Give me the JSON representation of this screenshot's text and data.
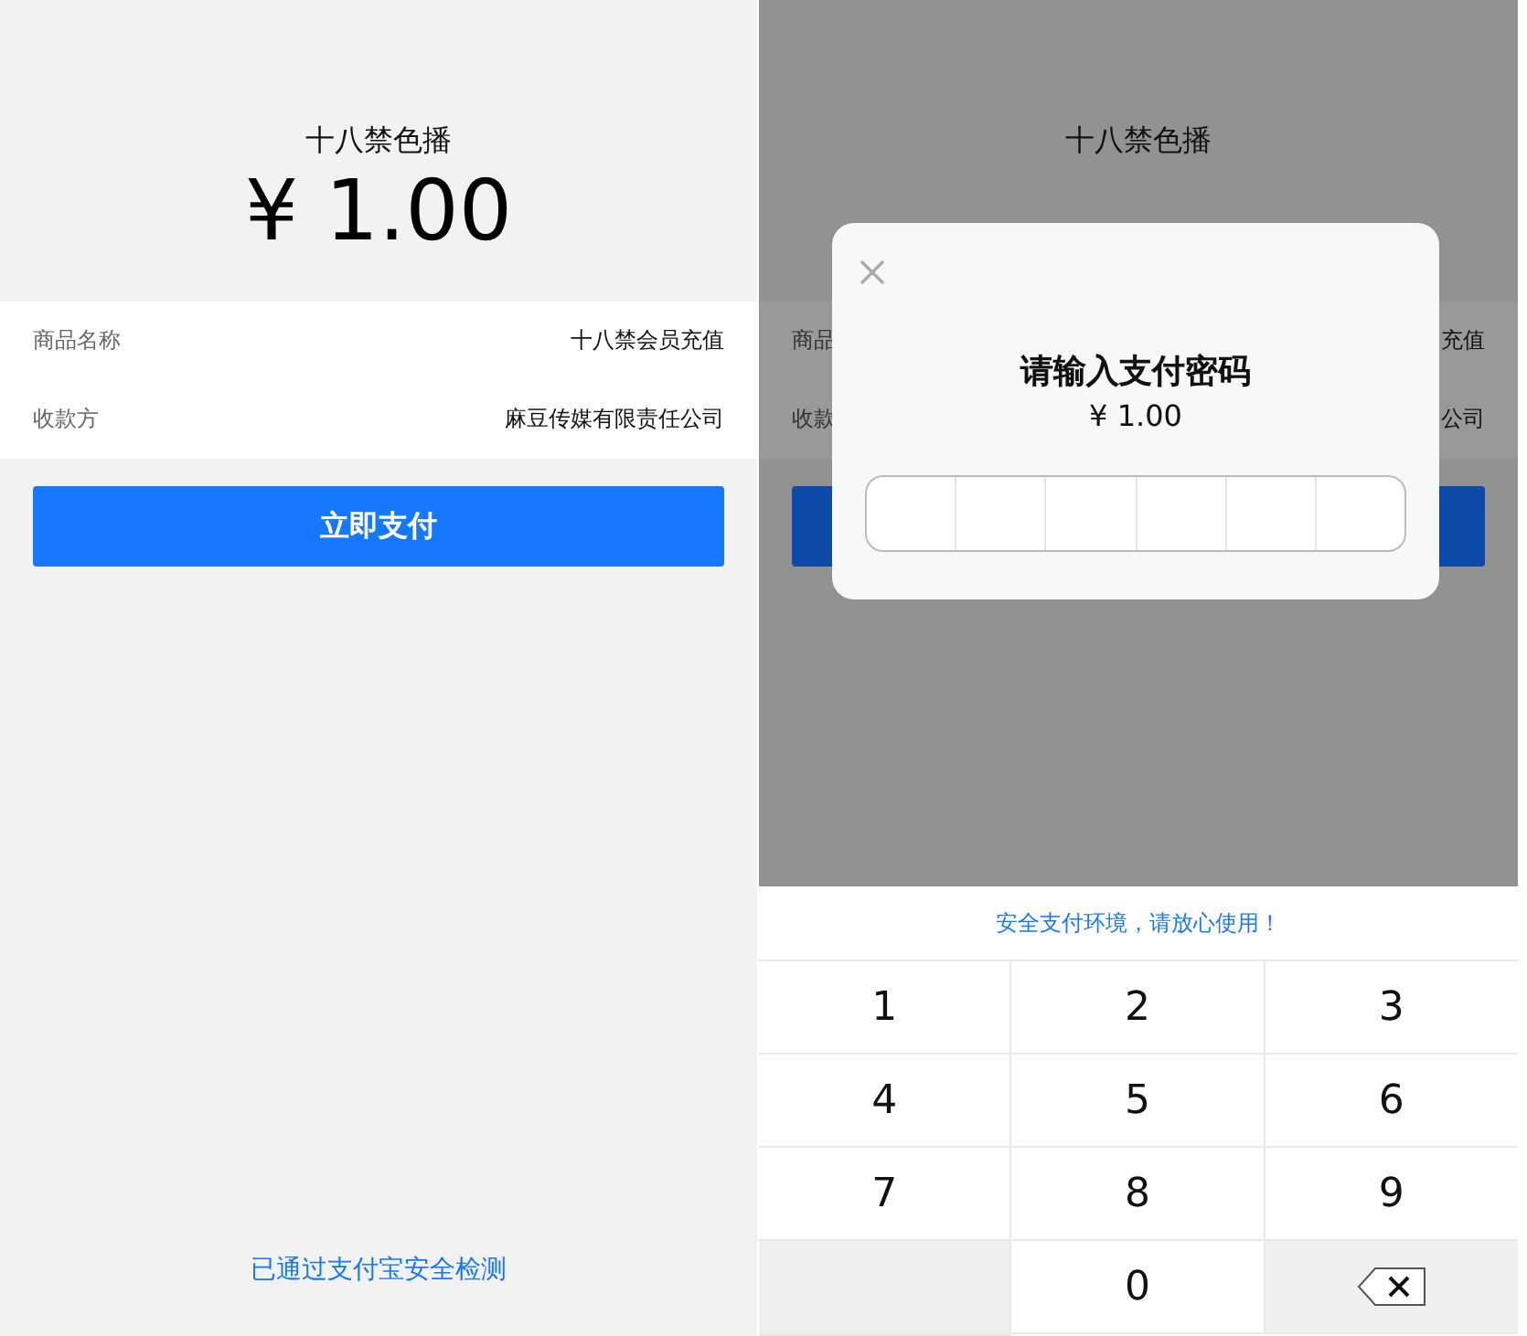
{
  "left_panel": {
    "dimmed": false,
    "title": "十八禁色播",
    "amount": "¥ 1.00",
    "rows": [
      {
        "label": "商品名称",
        "value": "十八禁会员充值"
      },
      {
        "label": "收款方",
        "value": "麻豆传媒有限责任公司"
      }
    ],
    "pay_button": {
      "label": "立即支付"
    },
    "footer_link": "已通过支付宝安全检测"
  },
  "right_panel": {
    "dimmed": true,
    "title": "十八禁色播",
    "rows": [
      {
        "label": "商品",
        "value": "充值"
      },
      {
        "label": "收款",
        "value": "公司"
      }
    ],
    "pay_button_covered": true,
    "modal": {
      "title": "请输入支付密码",
      "amount": "¥ 1.00",
      "cells": [
        {
          "filled": false
        },
        {
          "filled": false
        },
        {
          "filled": false
        },
        {
          "filled": false
        },
        {
          "filled": false
        },
        {
          "filled": false
        }
      ]
    },
    "keypad": {
      "tip": "安全支付环境，请放心使用！",
      "keys": [
        {
          "kind": "digit",
          "label": "1"
        },
        {
          "kind": "digit",
          "label": "2"
        },
        {
          "kind": "digit",
          "label": "3"
        },
        {
          "kind": "digit",
          "label": "4"
        },
        {
          "kind": "digit",
          "label": "5"
        },
        {
          "kind": "digit",
          "label": "6"
        },
        {
          "kind": "digit",
          "label": "7"
        },
        {
          "kind": "digit",
          "label": "8"
        },
        {
          "kind": "digit",
          "label": "9"
        },
        {
          "kind": "blank"
        },
        {
          "kind": "digit",
          "label": "0"
        },
        {
          "kind": "backspace"
        }
      ]
    }
  }
}
